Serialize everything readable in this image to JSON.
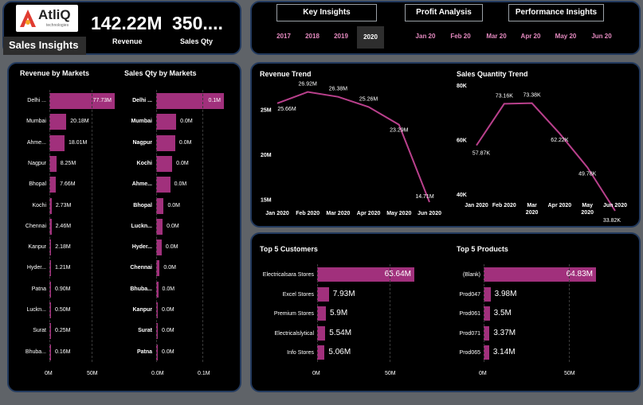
{
  "header": {
    "logo_text": "AtliQ",
    "logo_sub": "technologies",
    "page_title": "Sales Insights",
    "revenue_value": "142.22M",
    "revenue_label": "Revenue",
    "qty_value": "350....",
    "qty_label": "Sales Qty"
  },
  "nav": {
    "buttons": [
      "Key Insights",
      "Profit Analysis",
      "Performance Insights"
    ],
    "years": [
      "2017",
      "2018",
      "2019",
      "2020"
    ],
    "selected_year": "2020",
    "months": [
      "Jan 20",
      "Feb 20",
      "Mar 20",
      "Apr 20",
      "May 20",
      "Jun 20"
    ]
  },
  "colors": {
    "bar": "#a1307c",
    "line": "#b9408c",
    "accent_text": "#e58ac0",
    "panel_border": "#233a5e"
  },
  "revenue_by_markets": {
    "title": "Revenue by Markets",
    "axis": [
      "0M",
      "50M"
    ],
    "items": [
      {
        "label": "Delhi ...",
        "value": 77.73,
        "display": "77.73M"
      },
      {
        "label": "Mumbai",
        "value": 20.18,
        "display": "20.18M"
      },
      {
        "label": "Ahme...",
        "value": 18.01,
        "display": "18.01M"
      },
      {
        "label": "Nagpur",
        "value": 8.25,
        "display": "8.25M"
      },
      {
        "label": "Bhopal",
        "value": 7.66,
        "display": "7.66M"
      },
      {
        "label": "Kochi",
        "value": 2.73,
        "display": "2.73M"
      },
      {
        "label": "Chennai",
        "value": 2.46,
        "display": "2.46M"
      },
      {
        "label": "Kanpur",
        "value": 2.18,
        "display": "2.18M"
      },
      {
        "label": "Hyder...",
        "value": 1.21,
        "display": "1.21M"
      },
      {
        "label": "Patna",
        "value": 0.9,
        "display": "0.90M"
      },
      {
        "label": "Luckn...",
        "value": 0.5,
        "display": "0.50M"
      },
      {
        "label": "Surat",
        "value": 0.25,
        "display": "0.25M"
      },
      {
        "label": "Bhuba...",
        "value": 0.16,
        "display": "0.16M"
      }
    ]
  },
  "qty_by_markets": {
    "title": "Sales Qty by Markets",
    "axis": [
      "0.0M",
      "0.1M"
    ],
    "items": [
      {
        "label": "Delhi ...",
        "value": 0.135,
        "display": "0.1M"
      },
      {
        "label": "Mumbai",
        "value": 0.04,
        "display": "0.0M"
      },
      {
        "label": "Nagpur",
        "value": 0.038,
        "display": "0.0M"
      },
      {
        "label": "Kochi",
        "value": 0.032,
        "display": "0.0M"
      },
      {
        "label": "Ahme...",
        "value": 0.028,
        "display": "0.0M"
      },
      {
        "label": "Bhopal",
        "value": 0.015,
        "display": "0.0M"
      },
      {
        "label": "Luckn...",
        "value": 0.013,
        "display": "0.0M"
      },
      {
        "label": "Hyder...",
        "value": 0.011,
        "display": "0.0M"
      },
      {
        "label": "Chennai",
        "value": 0.007,
        "display": "0.0M"
      },
      {
        "label": "Bhuba...",
        "value": 0.004,
        "display": "0.0M"
      },
      {
        "label": "Kanpur",
        "value": 0.003,
        "display": "0.0M"
      },
      {
        "label": "Surat",
        "value": 0.002,
        "display": "0.0M"
      },
      {
        "label": "Patna",
        "value": 0.001,
        "display": "0.0M"
      }
    ]
  },
  "chart_data": [
    {
      "type": "line",
      "title": "Revenue Trend",
      "categories": [
        "Jan 2020",
        "Feb 2020",
        "Mar 2020",
        "Apr 2020",
        "May 2020",
        "Jun 2020"
      ],
      "values": [
        25.66,
        26.92,
        26.38,
        25.26,
        23.29,
        14.71
      ],
      "labels": [
        "25.66M",
        "26.92M",
        "26.38M",
        "25.26M",
        "23.29M",
        "14.71M"
      ],
      "yticks": [
        "25M",
        "20M",
        "15M"
      ],
      "ylim": [
        14,
        27.5
      ]
    },
    {
      "type": "line",
      "title": "Sales Quantity Trend",
      "categories": [
        "Jan 2020",
        "Feb 2020",
        "Mar 2020",
        "Apr 2020",
        "May 2020",
        "Jun 2020"
      ],
      "values": [
        57.87,
        73.16,
        73.38,
        62.22,
        49.78,
        33.82
      ],
      "labels": [
        "57.87K",
        "73.16K",
        "73.38K",
        "62.22K",
        "49.78K",
        "33.82K"
      ],
      "yticks": [
        "80K",
        "60K",
        "40K"
      ],
      "ylim": [
        30,
        80
      ]
    }
  ],
  "top_customers": {
    "title": "Top 5 Customers",
    "axis": [
      "0M",
      "50M"
    ],
    "items": [
      {
        "label": "Electricalsara Stores",
        "value": 65.64,
        "display": "65.64M"
      },
      {
        "label": "Excel Stores",
        "value": 7.93,
        "display": "7.93M"
      },
      {
        "label": "Premium Stores",
        "value": 5.9,
        "display": "5.9M"
      },
      {
        "label": "Electricalslytical",
        "value": 5.54,
        "display": "5.54M"
      },
      {
        "label": "Info Stores",
        "value": 5.06,
        "display": "5.06M"
      }
    ]
  },
  "top_products": {
    "title": "Top 5 Products",
    "axis": [
      "0M",
      "50M"
    ],
    "items": [
      {
        "label": "(Blank)",
        "value": 64.83,
        "display": "64.83M"
      },
      {
        "label": "Prod047",
        "value": 3.98,
        "display": "3.98M"
      },
      {
        "label": "Prod061",
        "value": 3.5,
        "display": "3.5M"
      },
      {
        "label": "Prod071",
        "value": 3.37,
        "display": "3.37M"
      },
      {
        "label": "Prod065",
        "value": 3.14,
        "display": "3.14M"
      }
    ]
  }
}
